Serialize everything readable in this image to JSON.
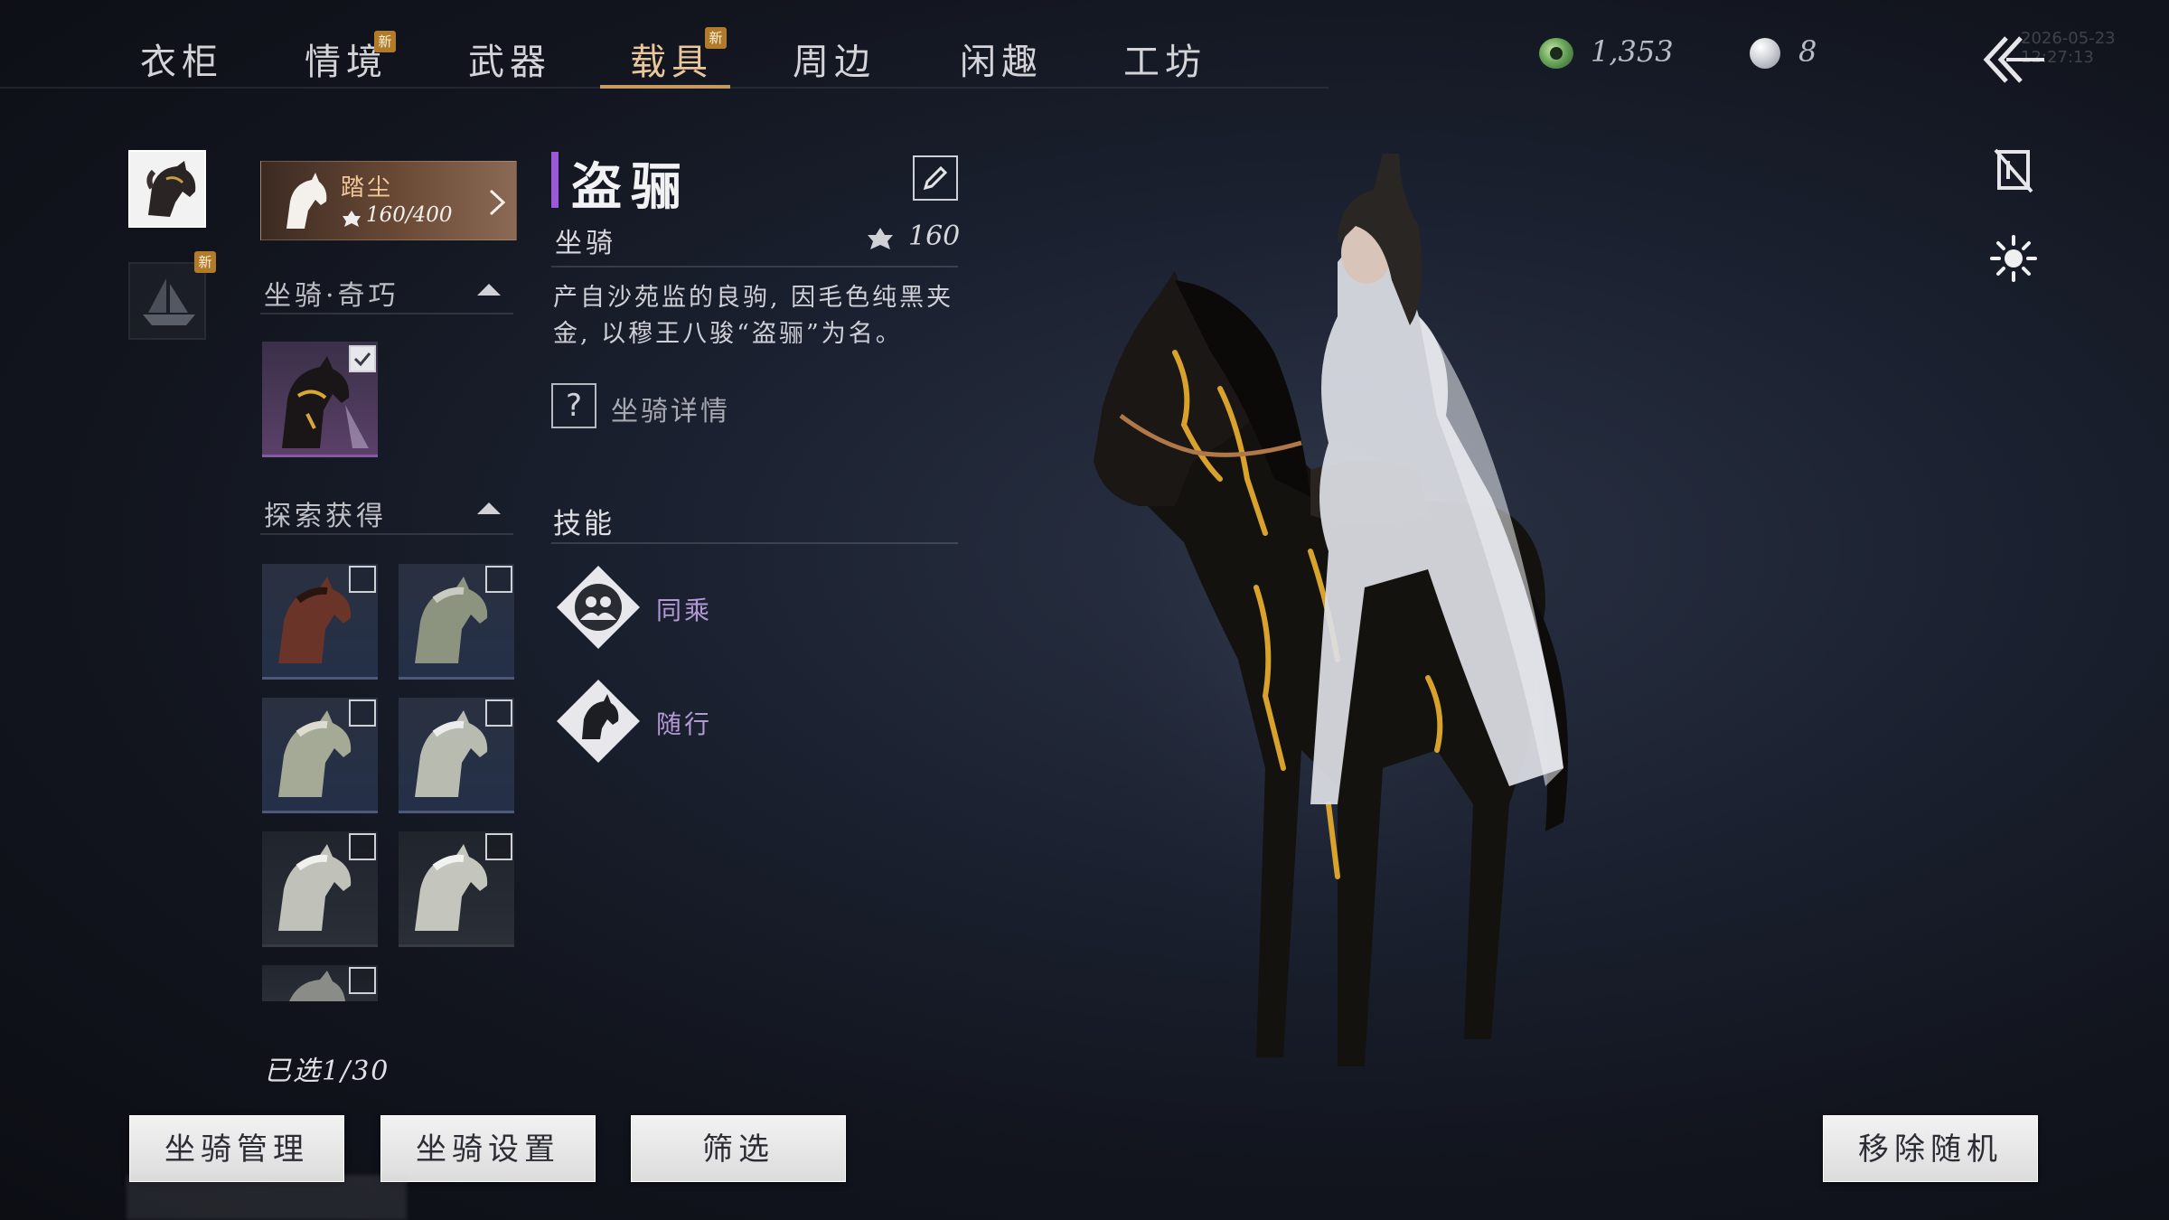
{
  "nav": {
    "tabs": [
      {
        "label": "衣柜",
        "new": false
      },
      {
        "label": "情境",
        "new": true
      },
      {
        "label": "武器",
        "new": false
      },
      {
        "label": "载具",
        "new": true
      },
      {
        "label": "周边",
        "new": false
      },
      {
        "label": "闲趣",
        "new": false
      },
      {
        "label": "工坊",
        "new": false
      }
    ],
    "active_tab": "载具",
    "new_badge": "新"
  },
  "currency": {
    "jade": {
      "icon": "jade-coin-icon",
      "value": "1,353"
    },
    "pearl": {
      "icon": "pearl-icon",
      "value": "8"
    }
  },
  "timestamp": "2026-05-23 12:27:13",
  "categories": [
    {
      "icon": "horse-category-icon",
      "new": false
    },
    {
      "icon": "boat-category-icon",
      "new": true
    }
  ],
  "current_mount": {
    "name": "踏尘",
    "progress": "160/400",
    "icon": "horse-head-icon"
  },
  "sections": {
    "special": {
      "label": "坐骑·奇巧"
    },
    "explore": {
      "label": "探索获得"
    }
  },
  "selected_count": "已选1/30",
  "detail": {
    "name": "盗骊",
    "type": "坐骑",
    "score": "160",
    "description": "产自沙苑监的良驹, 因毛色纯黑夹金, 以穆王八骏“盗骊”为名。",
    "detail_link": "坐骑详情",
    "skills_header": "技能",
    "skills": [
      {
        "label": "同乘",
        "icon": "ride-together-icon"
      },
      {
        "label": "随行",
        "icon": "horse-follow-icon"
      }
    ]
  },
  "buttons": {
    "manage": "坐骑管理",
    "settings": "坐骑设置",
    "filter": "筛选",
    "remove_random": "移除随机"
  },
  "colors": {
    "accent_gold": "#e9c79a",
    "underline": "#c49a62",
    "title_bar": "#9a5ad8",
    "skill_text": "#b39ad6",
    "badge": "#b27a2b"
  }
}
